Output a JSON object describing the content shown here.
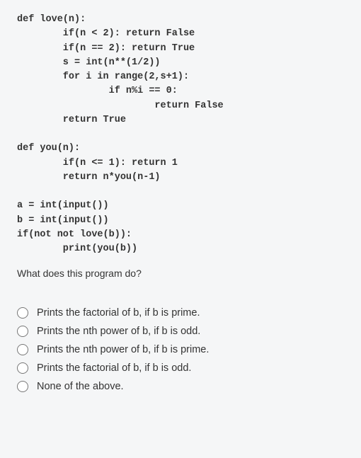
{
  "code": {
    "lines": [
      "def love(n):",
      "        if(n < 2): return False",
      "        if(n == 2): return True",
      "        s = int(n**(1/2))",
      "        for i in range(2,s+1):",
      "                if n%i == 0:",
      "                        return False",
      "        return True",
      "",
      "def you(n):",
      "        if(n <= 1): return 1",
      "        return n*you(n-1)",
      "",
      "a = int(input())",
      "b = int(input())",
      "if(not not love(b)):",
      "        print(you(b))"
    ]
  },
  "question": "What does this program do?",
  "options": [
    "Prints the factorial of b, if b is prime.",
    "Prints the nth power of b, if b is odd.",
    "Prints the nth power of b, if b is prime.",
    "Prints the factorial of b, if b is odd.",
    "None of the above."
  ]
}
